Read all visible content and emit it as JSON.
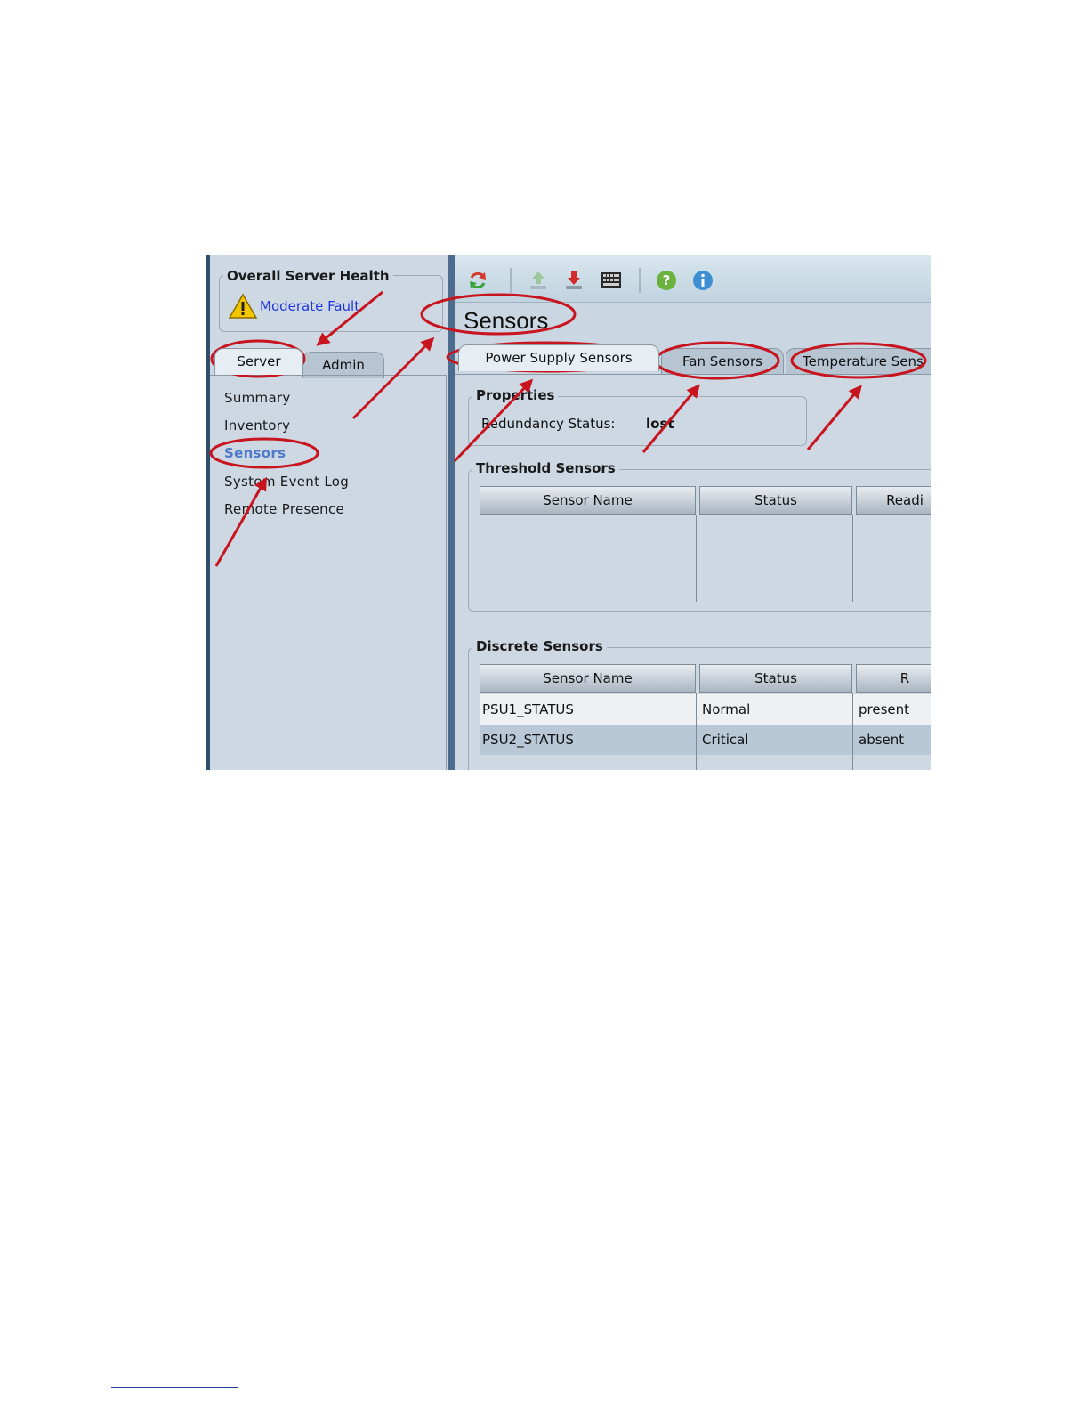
{
  "left_panel": {
    "health_title": "Overall Server Health",
    "health_status": "Moderate Fault",
    "tabs": [
      "Server",
      "Admin"
    ],
    "nav_items": [
      "Summary",
      "Inventory",
      "Sensors",
      "System Event Log",
      "Remote Presence"
    ],
    "active_nav": "Sensors"
  },
  "toolbar": {
    "icons": [
      "refresh-icon",
      "power-up-icon",
      "power-down-icon",
      "keyboard-icon",
      "help-icon",
      "info-icon"
    ]
  },
  "main": {
    "title": "Sensors",
    "tabs": [
      "Power Supply Sensors",
      "Fan Sensors",
      "Temperature Sens"
    ],
    "active_tab": "Power Supply Sensors",
    "properties": {
      "title": "Properties",
      "label": "Redundancy Status:",
      "value": "lost"
    },
    "threshold": {
      "title": "Threshold Sensors",
      "columns": [
        "Sensor Name",
        "Status",
        "Readi"
      ]
    },
    "discrete": {
      "title": "Discrete Sensors",
      "columns": [
        "Sensor Name",
        "Status",
        "R"
      ],
      "rows": [
        [
          "PSU1_STATUS",
          "Normal",
          "present"
        ],
        [
          "PSU2_STATUS",
          "Critical",
          "absent"
        ]
      ]
    }
  },
  "colors": {
    "annotation": "#c8141e",
    "link": "#1f37e0",
    "active_nav": "#4f79c9"
  }
}
